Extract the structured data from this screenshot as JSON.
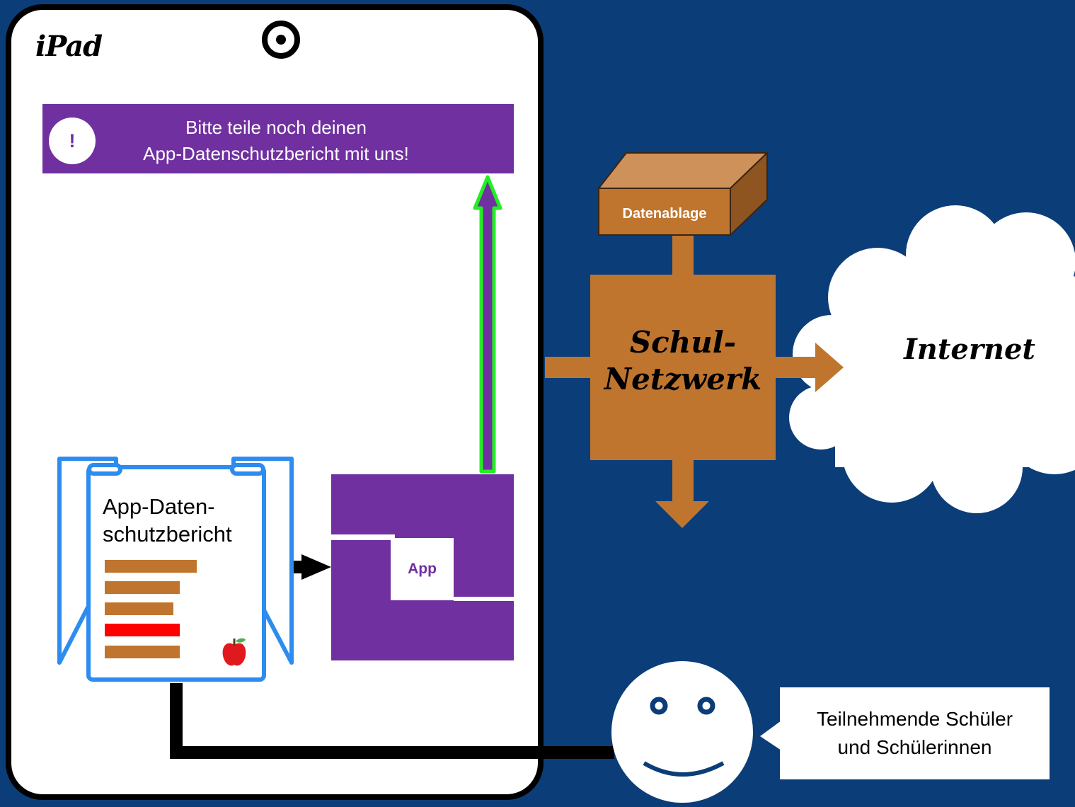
{
  "device": {
    "label": "iPad"
  },
  "notice": {
    "icon_text": "!",
    "line1": "Bitte teile noch deinen",
    "line2": "App-Datenschutzbericht mit uns!"
  },
  "report": {
    "title_line1": "App-Daten-",
    "title_line2": "schutzbericht",
    "badge_icon": "apple-icon"
  },
  "app": {
    "label": "App"
  },
  "storage": {
    "label": "Datenablage"
  },
  "network": {
    "line1": "Schul-",
    "line2": "Netzwerk"
  },
  "internet": {
    "label": "Internet"
  },
  "participants": {
    "line1": "Teilnehmende Schüler",
    "line2": "und Schülerinnen"
  },
  "colors": {
    "background": "#0b3d78",
    "purple": "#7030a0",
    "network_brown": "#c0752f",
    "report_blue": "#2d8cf0",
    "highlight_green": "#22ee22",
    "alert_red": "#ff0000"
  }
}
